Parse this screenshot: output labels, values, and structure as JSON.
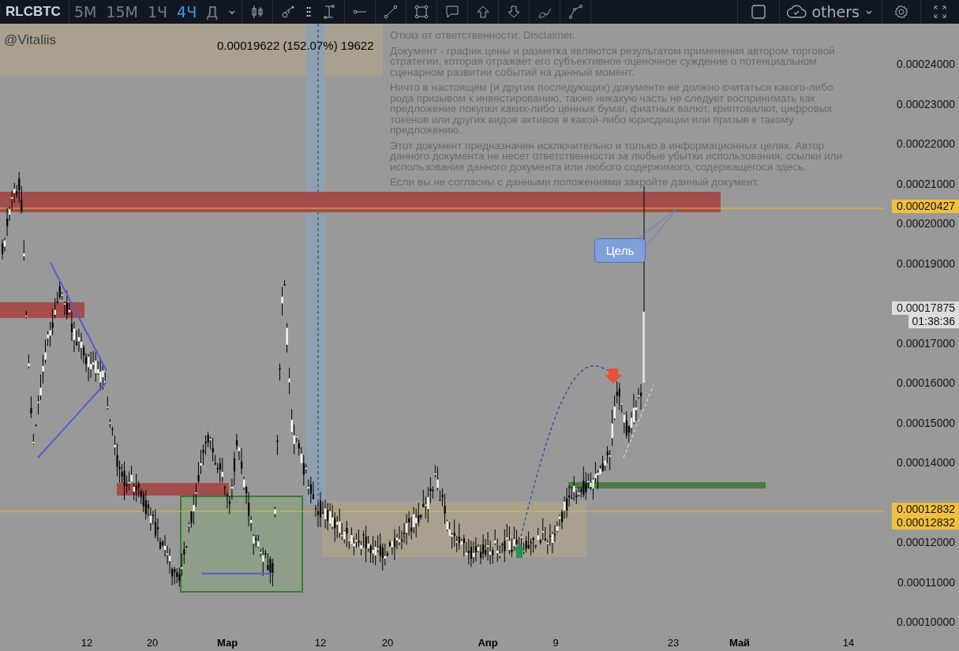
{
  "toolbar": {
    "symbol": "RLCBTC",
    "intervals": [
      {
        "label": "5М",
        "selected": false
      },
      {
        "label": "15М",
        "selected": false
      },
      {
        "label": "1Ч",
        "selected": false
      },
      {
        "label": "4Ч",
        "selected": true
      },
      {
        "label": "Д",
        "selected": false
      }
    ],
    "layout_name": "others"
  },
  "chart": {
    "author": "@Vitaliis",
    "measure_label": "0.00019622 (152.07%) 19622",
    "disclaimer": [
      "Отказ от ответственности. Disclaimer.",
      "Документ - график цены и разметка являются результатом применения автором торговой стратегии, которая отражает его субъективное оценочное суждение о потенциальном сценарном развитии событий на данный момент.",
      "Ничто в настоящем (и других последующих) документе не должно считаться какого-либо рода призывом к инвестированию, также никакую часть не следует воспринимать как предложение покупки каких-либо ценных бумаг, фиатных валют, криптовалют, цифровых токенов или других видов активов в какой-либо юрисдикции или призыв к такому предложению.",
      "Этот документ предназначен исключительно и только в информационных целях. Автор данного документа не несет ответственности за любые убытки использования, ссылки или использования данного документа или любого содержимого, содержащегося здесь.",
      "Если вы не согласны с данными положениями закройте данный документ."
    ],
    "callout": "Цель"
  },
  "price_axis": {
    "ticks": [
      "0.00024000",
      "0.00023000",
      "0.00022000",
      "0.00021000",
      "0.00020000",
      "0.00019000",
      "0.00017000",
      "0.00016000",
      "0.00015000",
      "0.00014000",
      "0.00012000",
      "0.00011000",
      "0.00010000"
    ],
    "labels": [
      {
        "text": "0.00020427",
        "kind": "alert"
      },
      {
        "text": "0.00017875",
        "kind": "last"
      },
      {
        "text": "0.00012832",
        "kind": "alert"
      },
      {
        "text": "0.00012832",
        "kind": "alert"
      }
    ],
    "countdown": "01:38:36"
  },
  "time_axis": [
    {
      "label": "12",
      "major": false
    },
    {
      "label": "20",
      "major": false
    },
    {
      "label": "Мар",
      "major": true
    },
    {
      "label": "12",
      "major": false
    },
    {
      "label": "20",
      "major": false
    },
    {
      "label": "Апр",
      "major": true
    },
    {
      "label": "9",
      "major": false
    },
    {
      "label": "23",
      "major": false
    },
    {
      "label": "Май",
      "major": true
    },
    {
      "label": "14",
      "major": false
    }
  ]
}
